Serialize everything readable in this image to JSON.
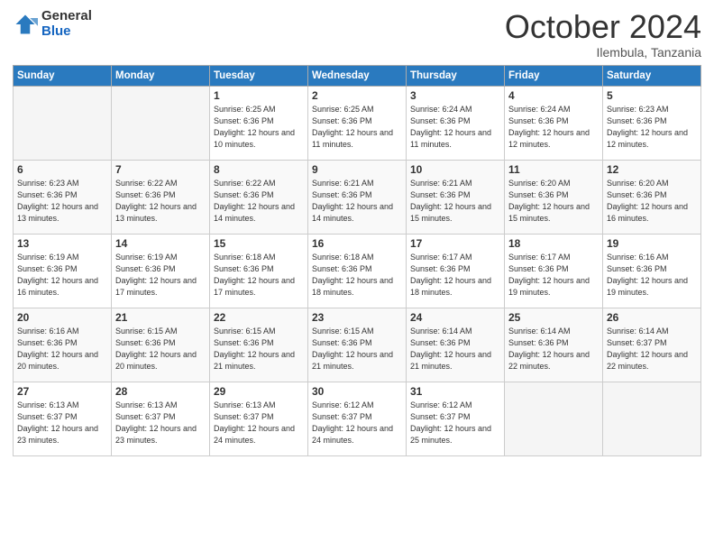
{
  "header": {
    "logo_general": "General",
    "logo_blue": "Blue",
    "month_title": "October 2024",
    "location": "Ilembula, Tanzania"
  },
  "days_of_week": [
    "Sunday",
    "Monday",
    "Tuesday",
    "Wednesday",
    "Thursday",
    "Friday",
    "Saturday"
  ],
  "weeks": [
    [
      {
        "day": "",
        "info": ""
      },
      {
        "day": "",
        "info": ""
      },
      {
        "day": "1",
        "info": "Sunrise: 6:25 AM\nSunset: 6:36 PM\nDaylight: 12 hours and 10 minutes."
      },
      {
        "day": "2",
        "info": "Sunrise: 6:25 AM\nSunset: 6:36 PM\nDaylight: 12 hours and 11 minutes."
      },
      {
        "day": "3",
        "info": "Sunrise: 6:24 AM\nSunset: 6:36 PM\nDaylight: 12 hours and 11 minutes."
      },
      {
        "day": "4",
        "info": "Sunrise: 6:24 AM\nSunset: 6:36 PM\nDaylight: 12 hours and 12 minutes."
      },
      {
        "day": "5",
        "info": "Sunrise: 6:23 AM\nSunset: 6:36 PM\nDaylight: 12 hours and 12 minutes."
      }
    ],
    [
      {
        "day": "6",
        "info": "Sunrise: 6:23 AM\nSunset: 6:36 PM\nDaylight: 12 hours and 13 minutes."
      },
      {
        "day": "7",
        "info": "Sunrise: 6:22 AM\nSunset: 6:36 PM\nDaylight: 12 hours and 13 minutes."
      },
      {
        "day": "8",
        "info": "Sunrise: 6:22 AM\nSunset: 6:36 PM\nDaylight: 12 hours and 14 minutes."
      },
      {
        "day": "9",
        "info": "Sunrise: 6:21 AM\nSunset: 6:36 PM\nDaylight: 12 hours and 14 minutes."
      },
      {
        "day": "10",
        "info": "Sunrise: 6:21 AM\nSunset: 6:36 PM\nDaylight: 12 hours and 15 minutes."
      },
      {
        "day": "11",
        "info": "Sunrise: 6:20 AM\nSunset: 6:36 PM\nDaylight: 12 hours and 15 minutes."
      },
      {
        "day": "12",
        "info": "Sunrise: 6:20 AM\nSunset: 6:36 PM\nDaylight: 12 hours and 16 minutes."
      }
    ],
    [
      {
        "day": "13",
        "info": "Sunrise: 6:19 AM\nSunset: 6:36 PM\nDaylight: 12 hours and 16 minutes."
      },
      {
        "day": "14",
        "info": "Sunrise: 6:19 AM\nSunset: 6:36 PM\nDaylight: 12 hours and 17 minutes."
      },
      {
        "day": "15",
        "info": "Sunrise: 6:18 AM\nSunset: 6:36 PM\nDaylight: 12 hours and 17 minutes."
      },
      {
        "day": "16",
        "info": "Sunrise: 6:18 AM\nSunset: 6:36 PM\nDaylight: 12 hours and 18 minutes."
      },
      {
        "day": "17",
        "info": "Sunrise: 6:17 AM\nSunset: 6:36 PM\nDaylight: 12 hours and 18 minutes."
      },
      {
        "day": "18",
        "info": "Sunrise: 6:17 AM\nSunset: 6:36 PM\nDaylight: 12 hours and 19 minutes."
      },
      {
        "day": "19",
        "info": "Sunrise: 6:16 AM\nSunset: 6:36 PM\nDaylight: 12 hours and 19 minutes."
      }
    ],
    [
      {
        "day": "20",
        "info": "Sunrise: 6:16 AM\nSunset: 6:36 PM\nDaylight: 12 hours and 20 minutes."
      },
      {
        "day": "21",
        "info": "Sunrise: 6:15 AM\nSunset: 6:36 PM\nDaylight: 12 hours and 20 minutes."
      },
      {
        "day": "22",
        "info": "Sunrise: 6:15 AM\nSunset: 6:36 PM\nDaylight: 12 hours and 21 minutes."
      },
      {
        "day": "23",
        "info": "Sunrise: 6:15 AM\nSunset: 6:36 PM\nDaylight: 12 hours and 21 minutes."
      },
      {
        "day": "24",
        "info": "Sunrise: 6:14 AM\nSunset: 6:36 PM\nDaylight: 12 hours and 21 minutes."
      },
      {
        "day": "25",
        "info": "Sunrise: 6:14 AM\nSunset: 6:36 PM\nDaylight: 12 hours and 22 minutes."
      },
      {
        "day": "26",
        "info": "Sunrise: 6:14 AM\nSunset: 6:37 PM\nDaylight: 12 hours and 22 minutes."
      }
    ],
    [
      {
        "day": "27",
        "info": "Sunrise: 6:13 AM\nSunset: 6:37 PM\nDaylight: 12 hours and 23 minutes."
      },
      {
        "day": "28",
        "info": "Sunrise: 6:13 AM\nSunset: 6:37 PM\nDaylight: 12 hours and 23 minutes."
      },
      {
        "day": "29",
        "info": "Sunrise: 6:13 AM\nSunset: 6:37 PM\nDaylight: 12 hours and 24 minutes."
      },
      {
        "day": "30",
        "info": "Sunrise: 6:12 AM\nSunset: 6:37 PM\nDaylight: 12 hours and 24 minutes."
      },
      {
        "day": "31",
        "info": "Sunrise: 6:12 AM\nSunset: 6:37 PM\nDaylight: 12 hours and 25 minutes."
      },
      {
        "day": "",
        "info": ""
      },
      {
        "day": "",
        "info": ""
      }
    ]
  ]
}
